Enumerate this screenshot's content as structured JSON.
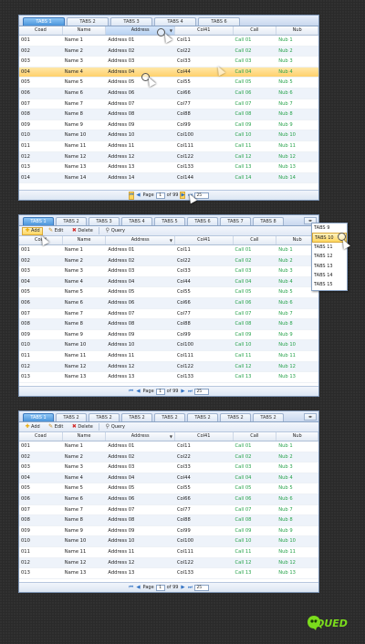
{
  "colors": {
    "accent": "#4a94db",
    "green_text": "#26a24a",
    "selection": "#ffd06a"
  },
  "grid1": {
    "tabs": [
      "TABS 1",
      "TABS 2",
      "TABS 3",
      "TABS 4",
      "TABS 6"
    ],
    "headers": [
      "Coad",
      "Name",
      "Address",
      "Col41",
      "Call",
      "Nub"
    ],
    "rows": [
      [
        "001",
        "Name 1",
        "Address 01",
        "Col11",
        "Call 01",
        "Nub 1"
      ],
      [
        "002",
        "Name 2",
        "Address 02",
        "Col22",
        "Call 02",
        "Nub 2"
      ],
      [
        "003",
        "Name 3",
        "Address 03",
        "Col33",
        "Call 03",
        "Nub 3"
      ],
      [
        "004",
        "Name 4",
        "Address 04",
        "Col44",
        "Call 04",
        "Nub 4"
      ],
      [
        "005",
        "Name 5",
        "Address 05",
        "Col55",
        "Call 05",
        "Nub 5"
      ],
      [
        "006",
        "Name 6",
        "Address 06",
        "Col66",
        "Call 06",
        "Nub 6"
      ],
      [
        "007",
        "Name 7",
        "Address 07",
        "Col77",
        "Call 07",
        "Nub 7"
      ],
      [
        "008",
        "Name 8",
        "Address 08",
        "Col88",
        "Call 08",
        "Nub 8"
      ],
      [
        "009",
        "Name 9",
        "Address 09",
        "Col99",
        "Call 09",
        "Nub 9"
      ],
      [
        "010",
        "Name 10",
        "Address 10",
        "Col100",
        "Call 10",
        "Nub 10"
      ],
      [
        "011",
        "Name 11",
        "Address 11",
        "Col111",
        "Call 11",
        "Nub 11"
      ],
      [
        "012",
        "Name 12",
        "Address 12",
        "Col122",
        "Call 12",
        "Nub 12"
      ],
      [
        "013",
        "Name 13",
        "Address 13",
        "Col133",
        "Call 13",
        "Nub 13"
      ],
      [
        "014",
        "Name 14",
        "Address 14",
        "Col144",
        "Call 14",
        "Nub 14"
      ]
    ],
    "pager": {
      "page_label": "Page",
      "page_value": "1",
      "of_label": "of 99",
      "size_value": "25"
    }
  },
  "grid2": {
    "tabs": [
      "TABS 1",
      "TABS 2",
      "TABS 3",
      "TABS 4",
      "TABS 5",
      "TABS 6",
      "TABS 7",
      "TABS 8"
    ],
    "toolbar": {
      "add": "Add",
      "edit": "Edit",
      "delete": "Delete",
      "query": "Query"
    },
    "headers": [
      "Coad",
      "Name",
      "Address",
      "Col41",
      "Call",
      "Nub"
    ],
    "rows": [
      [
        "001",
        "Name 1",
        "Address 01",
        "Col11",
        "Call 01",
        "Nub 1"
      ],
      [
        "002",
        "Name 2",
        "Address 02",
        "Col22",
        "Call 02",
        "Nub 2"
      ],
      [
        "003",
        "Name 3",
        "Address 03",
        "Col33",
        "Call 03",
        "Nub 3"
      ],
      [
        "004",
        "Name 4",
        "Address 04",
        "Col44",
        "Call 04",
        "Nub 4"
      ],
      [
        "005",
        "Name 5",
        "Address 05",
        "Col55",
        "Call 05",
        "Nub 5"
      ],
      [
        "006",
        "Name 6",
        "Address 06",
        "Col66",
        "Call 06",
        "Nub 6"
      ],
      [
        "007",
        "Name 7",
        "Address 07",
        "Col77",
        "Call 07",
        "Nub 7"
      ],
      [
        "008",
        "Name 8",
        "Address 08",
        "Col88",
        "Call 08",
        "Nub 8"
      ],
      [
        "009",
        "Name 9",
        "Address 09",
        "Col99",
        "Call 09",
        "Nub 9"
      ],
      [
        "010",
        "Name 10",
        "Address 10",
        "Col100",
        "Call 10",
        "Nub 10"
      ],
      [
        "011",
        "Name 11",
        "Address 11",
        "Col111",
        "Call 11",
        "Nub 11"
      ],
      [
        "012",
        "Name 12",
        "Address 12",
        "Col122",
        "Call 12",
        "Nub 12"
      ],
      [
        "013",
        "Name 13",
        "Address 13",
        "Col133",
        "Call 13",
        "Nub 13"
      ]
    ],
    "pager": {
      "page_label": "Page",
      "page_value": "1",
      "of_label": "of 99",
      "size_value": "25"
    },
    "overflow_menu": [
      "TABS 9",
      "TABS 10",
      "TABS 11",
      "TABS 12",
      "TABS 13",
      "TABS 14",
      "TABS 15"
    ]
  },
  "grid3": {
    "tabs": [
      "TABS 1",
      "TABS 2",
      "TABS 2",
      "TABS 2",
      "TABS 2",
      "TABS 2",
      "TABS 2",
      "TABS 2"
    ],
    "toolbar": {
      "add": "Add",
      "edit": "Edit",
      "delete": "Delete",
      "query": "Query"
    },
    "headers": [
      "Coad",
      "Name",
      "Address",
      "Col41",
      "Call",
      "Nub"
    ],
    "rows": [
      [
        "001",
        "Name 1",
        "Address 01",
        "Col11",
        "Call 01",
        "Nub 1"
      ],
      [
        "002",
        "Name 2",
        "Address 02",
        "Col22",
        "Call 02",
        "Nub 2"
      ],
      [
        "003",
        "Name 3",
        "Address 03",
        "Col33",
        "Call 03",
        "Nub 3"
      ],
      [
        "004",
        "Name 4",
        "Address 04",
        "Col44",
        "Call 04",
        "Nub 4"
      ],
      [
        "005",
        "Name 5",
        "Address 05",
        "Col55",
        "Call 05",
        "Nub 5"
      ],
      [
        "006",
        "Name 6",
        "Address 06",
        "Col66",
        "Call 06",
        "Nub 6"
      ],
      [
        "007",
        "Name 7",
        "Address 07",
        "Col77",
        "Call 07",
        "Nub 7"
      ],
      [
        "008",
        "Name 8",
        "Address 08",
        "Col88",
        "Call 08",
        "Nub 8"
      ],
      [
        "009",
        "Name 9",
        "Address 09",
        "Col99",
        "Call 09",
        "Nub 9"
      ],
      [
        "010",
        "Name 10",
        "Address 10",
        "Col100",
        "Call 10",
        "Nub 10"
      ],
      [
        "011",
        "Name 11",
        "Address 11",
        "Col111",
        "Call 11",
        "Nub 11"
      ],
      [
        "012",
        "Name 12",
        "Address 12",
        "Col122",
        "Call 12",
        "Nub 12"
      ],
      [
        "013",
        "Name 13",
        "Address 13",
        "Col133",
        "Call 13",
        "Nub 13"
      ]
    ],
    "pager": {
      "page_label": "Page",
      "page_value": "1",
      "of_label": "of 99",
      "size_value": "25"
    }
  },
  "logo": {
    "text": "QUED"
  }
}
